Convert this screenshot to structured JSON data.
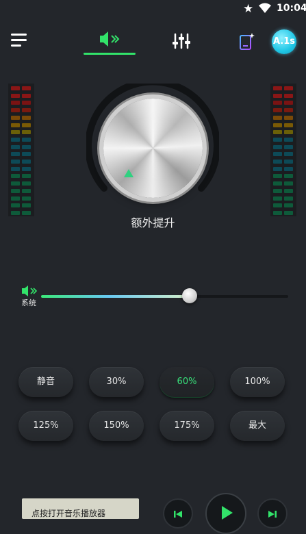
{
  "status_bar": {
    "time": "10:04",
    "icons": [
      "star-icon",
      "wifi-icon",
      "battery-icon"
    ]
  },
  "topbar": {
    "menu_icon": "hamburger-menu-icon",
    "tabs": [
      {
        "icon": "speaker-volume-icon",
        "active": true
      },
      {
        "icon": "equalizer-sliders-icon",
        "active": false
      }
    ],
    "theme_icon": "phone-theme-icon",
    "avatar_text": "A.1s"
  },
  "accent_color": "#32e36a",
  "knob": {
    "label": "额外提升",
    "level_percent": 60
  },
  "volume_slider": {
    "label": "系统",
    "icon": "speaker-volume-icon",
    "value_fraction": 0.6
  },
  "presets": [
    {
      "label": "静音",
      "active": false
    },
    {
      "label": "30%",
      "active": false
    },
    {
      "label": "60%",
      "active": true
    },
    {
      "label": "100%",
      "active": false
    },
    {
      "label": "125%",
      "active": false
    },
    {
      "label": "150%",
      "active": false
    },
    {
      "label": "175%",
      "active": false
    },
    {
      "label": "最大",
      "active": false
    }
  ],
  "player": {
    "prompt": "点按打开音乐播放器",
    "controls": [
      "previous-track-icon",
      "play-icon",
      "next-track-icon"
    ]
  }
}
